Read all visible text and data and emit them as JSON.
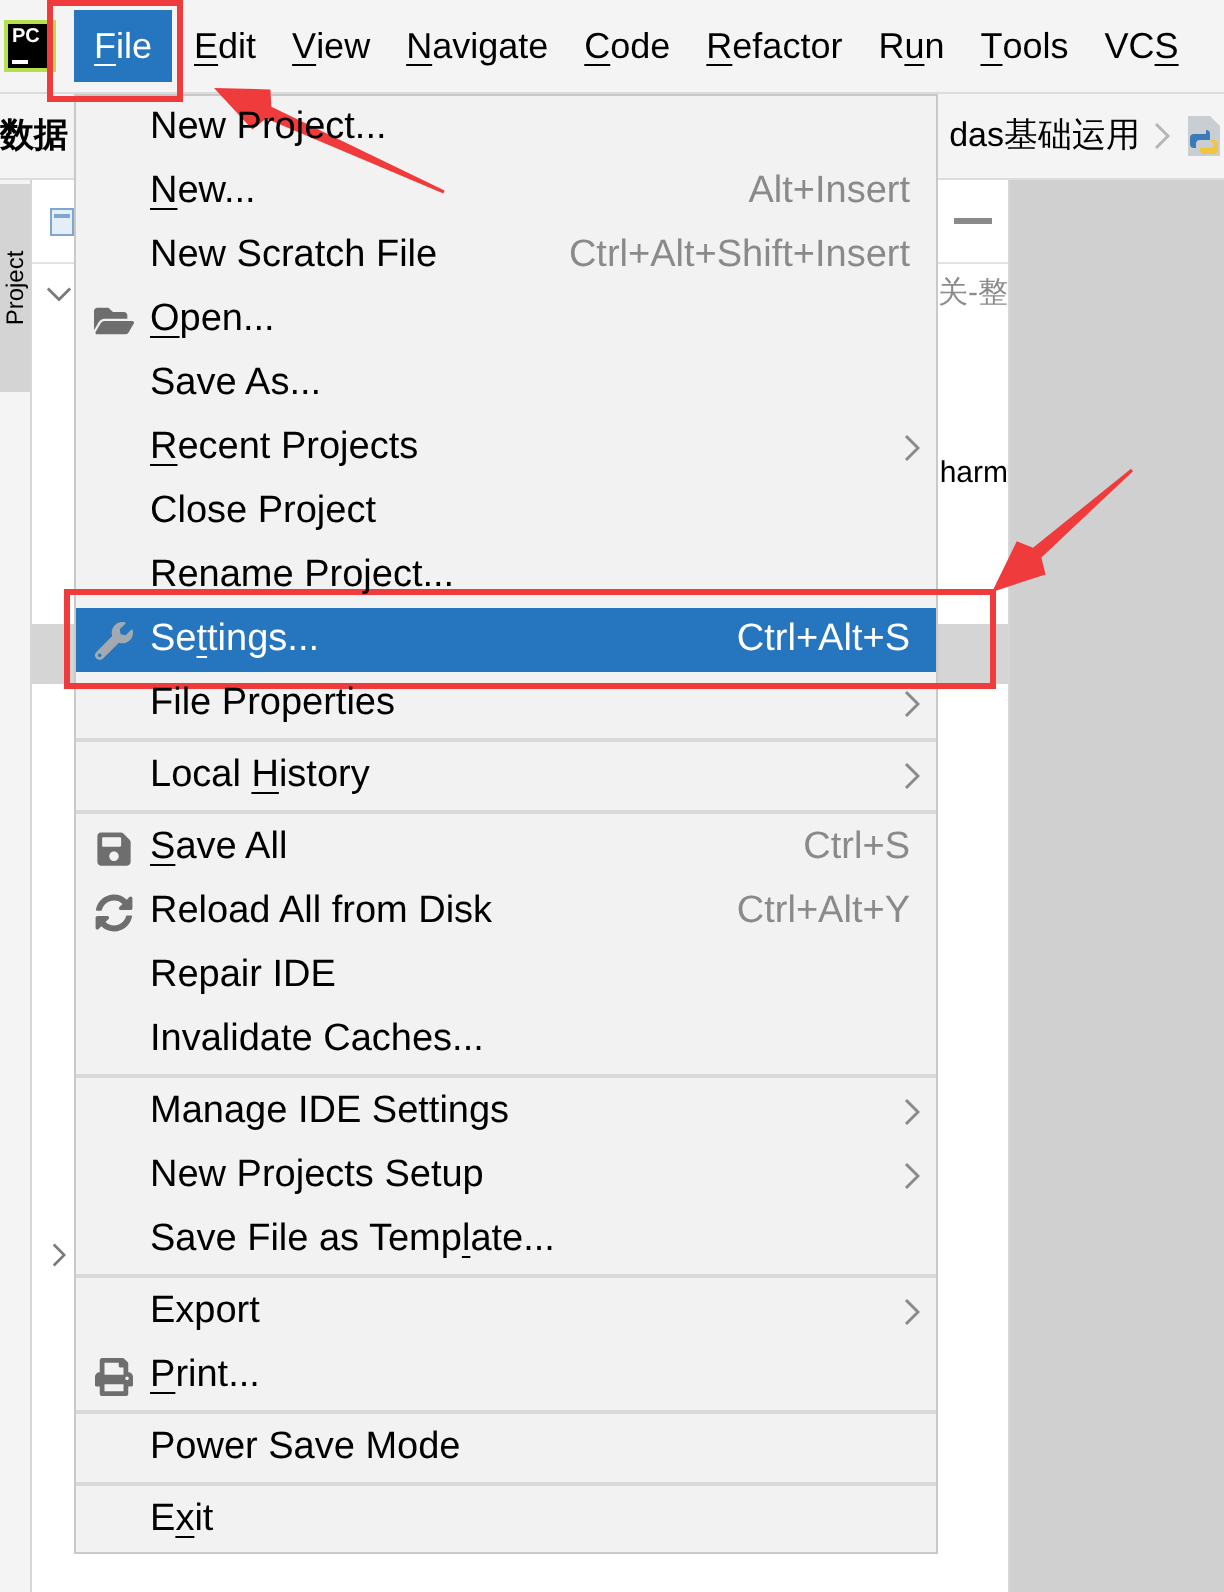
{
  "menu_bar": {
    "logo": "PC",
    "items": [
      {
        "label": "File",
        "selected": true
      },
      {
        "label": "Edit",
        "selected": false
      },
      {
        "label": "View",
        "selected": false
      },
      {
        "label": "Navigate",
        "selected": false
      },
      {
        "label": "Code",
        "selected": false
      },
      {
        "label": "Refactor",
        "selected": false
      },
      {
        "label": "Run",
        "selected": false
      },
      {
        "label": "Tools",
        "selected": false
      },
      {
        "label": "VCS",
        "selected": false
      }
    ]
  },
  "navigation_bar": {
    "project": "数据",
    "path": "das基础运用"
  },
  "tool_strip": {
    "label": "Project"
  },
  "project_panel": {
    "rows": [
      {
        "kind": "folder",
        "expanded": true,
        "path": "关-整",
        "selected": false
      },
      {
        "kind": "file",
        "name": "harm",
        "selected": false
      },
      {
        "kind": "file",
        "selected": true
      },
      {
        "kind": "folder",
        "expanded": false,
        "selected": false
      }
    ]
  },
  "file_menu": {
    "items": [
      {
        "kind": "item",
        "label": "New Project...",
        "submenu": false,
        "selected": false
      },
      {
        "kind": "item",
        "label": "New...",
        "shortcut": "Alt+Insert",
        "submenu": false,
        "selected": false
      },
      {
        "kind": "item",
        "label": "New Scratch File",
        "shortcut": "Ctrl+Alt+Shift+Insert",
        "submenu": false,
        "selected": false
      },
      {
        "kind": "item",
        "label": "Open...",
        "submenu": false,
        "selected": false
      },
      {
        "kind": "item",
        "label": "Save As...",
        "submenu": false,
        "selected": false
      },
      {
        "kind": "item",
        "label": "Recent Projects",
        "submenu": true,
        "selected": false
      },
      {
        "kind": "item",
        "label": "Close Project",
        "submenu": false,
        "selected": false
      },
      {
        "kind": "item",
        "label": "Rename Project...",
        "submenu": false,
        "selected": false
      },
      {
        "kind": "item",
        "label": "Settings...",
        "shortcut": "Ctrl+Alt+S",
        "submenu": false,
        "selected": true
      },
      {
        "kind": "item",
        "label": "File Properties",
        "submenu": true,
        "selected": false
      },
      {
        "kind": "separator"
      },
      {
        "kind": "item",
        "label": "Local History",
        "submenu": true,
        "selected": false
      },
      {
        "kind": "separator"
      },
      {
        "kind": "item",
        "label": "Save All",
        "shortcut": "Ctrl+S",
        "submenu": false,
        "selected": false
      },
      {
        "kind": "item",
        "label": "Reload All from Disk",
        "shortcut": "Ctrl+Alt+Y",
        "submenu": false,
        "selected": false
      },
      {
        "kind": "item",
        "label": "Repair IDE",
        "submenu": false,
        "selected": false
      },
      {
        "kind": "item",
        "label": "Invalidate Caches...",
        "submenu": false,
        "selected": false
      },
      {
        "kind": "separator"
      },
      {
        "kind": "item",
        "label": "Manage IDE Settings",
        "submenu": true,
        "selected": false
      },
      {
        "kind": "item",
        "label": "New Projects Setup",
        "submenu": true,
        "selected": false
      },
      {
        "kind": "item",
        "label": "Save File as Template...",
        "submenu": false,
        "selected": false
      },
      {
        "kind": "separator"
      },
      {
        "kind": "item",
        "label": "Export",
        "submenu": true,
        "selected": false
      },
      {
        "kind": "item",
        "label": "Print...",
        "submenu": false,
        "selected": false
      },
      {
        "kind": "separator"
      },
      {
        "kind": "item",
        "label": "Power Save Mode",
        "submenu": false,
        "selected": false
      },
      {
        "kind": "separator"
      },
      {
        "kind": "item",
        "label": "Exit",
        "submenu": false,
        "selected": false
      }
    ]
  }
}
